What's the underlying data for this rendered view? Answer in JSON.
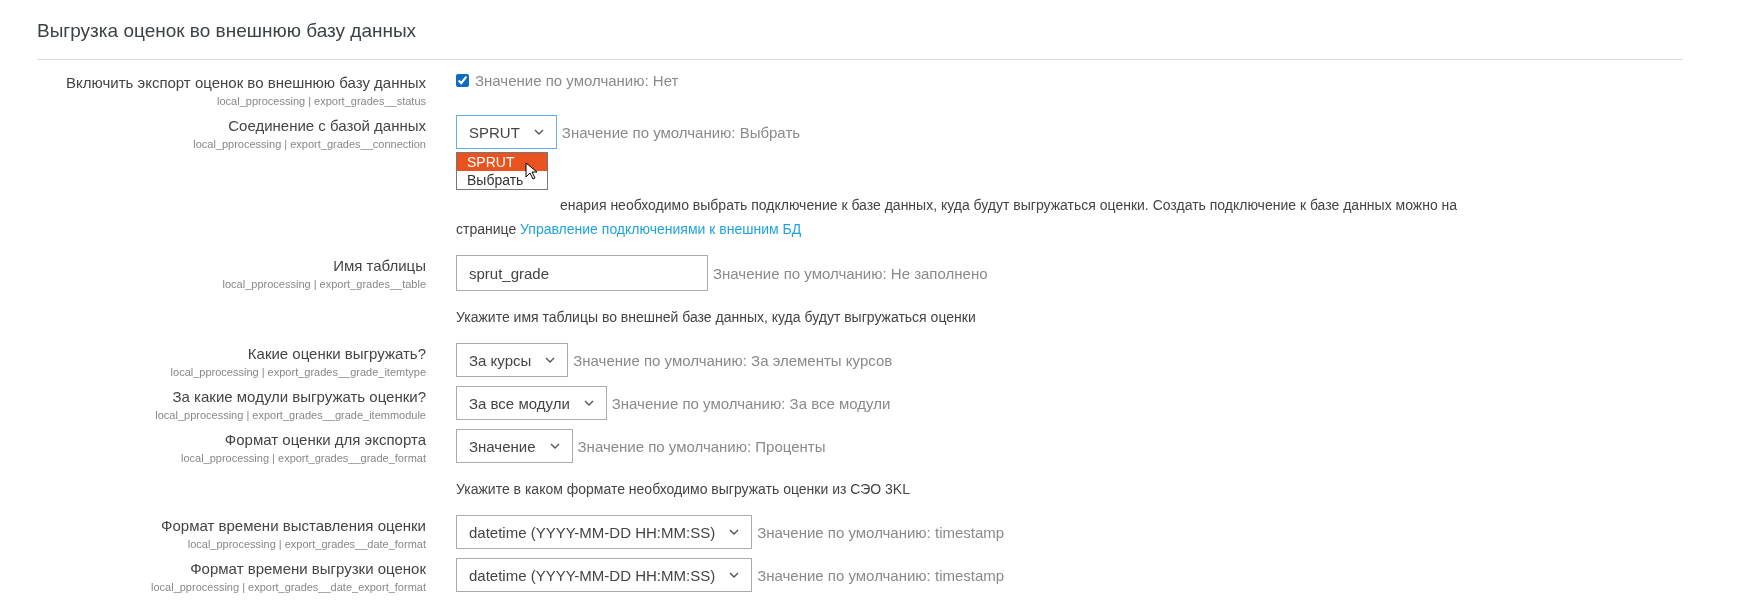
{
  "section": {
    "title": "Выгрузка оценок во внешнюю базу данных"
  },
  "settings": [
    {
      "label": "Включить экспорт оценок во внешнюю базу данных",
      "key": "local_pprocessing | export_grades__status",
      "control": {
        "kind": "checkbox",
        "checked": true
      },
      "default": "Значение по умолчанию: Нет"
    },
    {
      "label": "Соединение с базой данных",
      "key": "local_pprocessing | export_grades__connection",
      "control": {
        "kind": "select",
        "value": "SPRUT",
        "expanded": true,
        "options": [
          {
            "label": "SPRUT",
            "selected": true
          },
          {
            "label": "Выбрать",
            "selected": false
          }
        ]
      },
      "default": "Значение по умолчанию: Выбрать",
      "description": "енария необходимо выбрать подключение к базе данных, куда будут выгружаться оценки. Создать подключение к базе данных можно на странице ",
      "link": "Управление подключениями к внешним БД"
    },
    {
      "label": "Имя таблицы",
      "key": "local_pprocessing | export_grades__table",
      "control": {
        "kind": "text",
        "value": "sprut_grade"
      },
      "default": "Значение по умолчанию: Не заполнено",
      "description": "Укажите имя таблицы во внешней базе данных, куда будут выгружаться оценки"
    },
    {
      "label": "Какие оценки выгружать?",
      "key": "local_pprocessing | export_grades__grade_itemtype",
      "control": {
        "kind": "select",
        "value": "За курсы",
        "expanded": false
      },
      "default": "Значение по умолчанию: За элементы курсов"
    },
    {
      "label": "За какие модули выгружать оценки?",
      "key": "local_pprocessing | export_grades__grade_itemmodule",
      "control": {
        "kind": "select",
        "value": "За все модули",
        "expanded": false
      },
      "default": "Значение по умолчанию: За все модули"
    },
    {
      "label": "Формат оценки для экспорта",
      "key": "local_pprocessing | export_grades__grade_format",
      "control": {
        "kind": "select",
        "value": "Значение",
        "expanded": false
      },
      "default": "Значение по умолчанию: Проценты",
      "description": "Укажите в каком формате необходимо выгружать оценки из СЭО 3KL"
    },
    {
      "label": "Формат времени выставления оценки",
      "key": "local_pprocessing | export_grades__date_format",
      "control": {
        "kind": "select",
        "value": "datetime (YYYY-MM-DD HH:MM:SS)",
        "expanded": false
      },
      "default": "Значение по умолчанию: timestamp"
    },
    {
      "label": "Формат времени выгрузки оценок",
      "key": "local_pprocessing | export_grades__date_export_format",
      "control": {
        "kind": "select",
        "value": "datetime (YYYY-MM-DD HH:MM:SS)",
        "expanded": false
      },
      "default": "Значение по умолчанию: timestamp"
    }
  ]
}
